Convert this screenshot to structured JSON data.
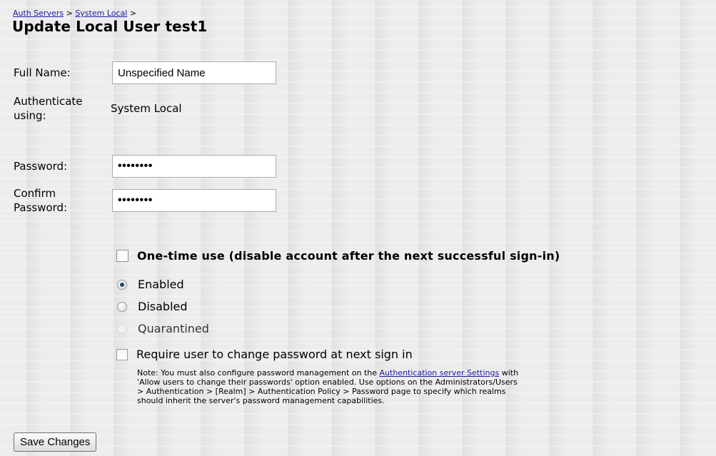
{
  "breadcrumb": {
    "auth_servers": "Auth Servers",
    "sep1": " > ",
    "system_local": "System Local",
    "sep2": " >"
  },
  "page_title": "Update Local User test1",
  "form": {
    "full_name_label": "Full Name:",
    "full_name_value": "Unspecified Name",
    "authenticate_label_line1": "Authenticate",
    "authenticate_label_line2": "using:",
    "authenticate_value": "System Local",
    "password_label": "Password:",
    "password_value": "••••••••",
    "confirm_label_line1": "Confirm",
    "confirm_label_line2": "Password:",
    "confirm_value": "••••••••"
  },
  "options": {
    "one_time_label": "One-time use (disable account after the next successful sign-in)",
    "one_time_checked": false,
    "status": [
      {
        "label": "Enabled",
        "checked": true,
        "disabled": false
      },
      {
        "label": "Disabled",
        "checked": false,
        "disabled": false
      },
      {
        "label": "Quarantined",
        "checked": false,
        "disabled": true
      }
    ],
    "require_change_label": "Require user to change password at next sign in",
    "require_change_checked": false
  },
  "note": {
    "line1_prefix": "Note: You must also configure password management on the ",
    "line1_link": "Authentication server Settings",
    "line1_suffix": " with",
    "line2": "'Allow users to change their passwords' option enabled. Use options on the Administrators/Users",
    "line3": "> Authentication > [Realm] > Authentication Policy > Password page to specify which realms",
    "line4": "should inherit the server's password management capabilities."
  },
  "save_button_label": "Save Changes"
}
